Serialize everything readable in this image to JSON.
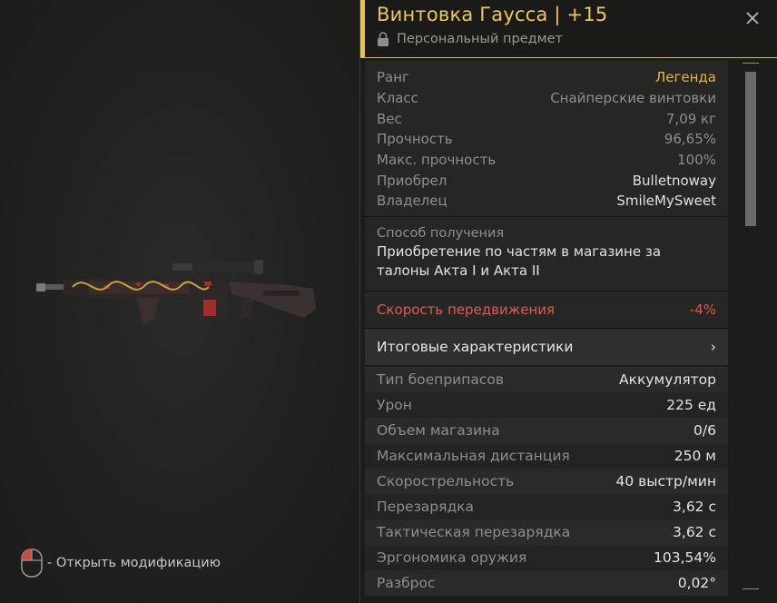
{
  "item": {
    "title": "Винтовка Гаусса | +15",
    "subtitle": "Персональный предмет",
    "accent_color": "#e9c34e"
  },
  "info": [
    {
      "label": "Ранг",
      "value": "Легенда",
      "style": "gold"
    },
    {
      "label": "Класс",
      "value": "Снайперские винтовки",
      "style": "dim"
    },
    {
      "label": "Вес",
      "value": "7,09 кг",
      "style": "dim"
    },
    {
      "label": "Прочность",
      "value": "96,65%",
      "style": "dim"
    },
    {
      "label": "Макс. прочность",
      "value": "100%",
      "style": "dim"
    },
    {
      "label": "Приобрел",
      "value": "Bulletnoway",
      "style": "bright"
    },
    {
      "label": "Владелец",
      "value": "SmileMySweet",
      "style": "bright"
    }
  ],
  "acquisition": {
    "label": "Способ получения",
    "text": "Приобретение по частям в магазине за талоны Акта I и Акта II"
  },
  "movement": {
    "label": "Скорость передвижения",
    "value": "-4%",
    "color": "#e05a52"
  },
  "totals": {
    "label": "Итоговые характеристики",
    "chevron": "›"
  },
  "stats": [
    {
      "label": "Тип боеприпасов",
      "value": "Аккумулятор"
    },
    {
      "label": "Урон",
      "value": "225 ед"
    },
    {
      "label": "Объем магазина",
      "value": "0/6"
    },
    {
      "label": "Максимальная дистанция",
      "value": "250 м"
    },
    {
      "label": "Скорострельность",
      "value": "40 выстр/мин"
    },
    {
      "label": "Перезарядка",
      "value": "3,62 с"
    },
    {
      "label": "Тактическая перезарядка",
      "value": "3,62 с"
    },
    {
      "label": "Эргономика оружия",
      "value": "103,54%"
    },
    {
      "label": "Разброс",
      "value": "0,02°"
    }
  ],
  "hint": {
    "text": "- Открыть модификацию",
    "icon": "mouse-left-click-icon"
  },
  "icons": {
    "close": "close-icon",
    "lock": "lock-icon"
  }
}
